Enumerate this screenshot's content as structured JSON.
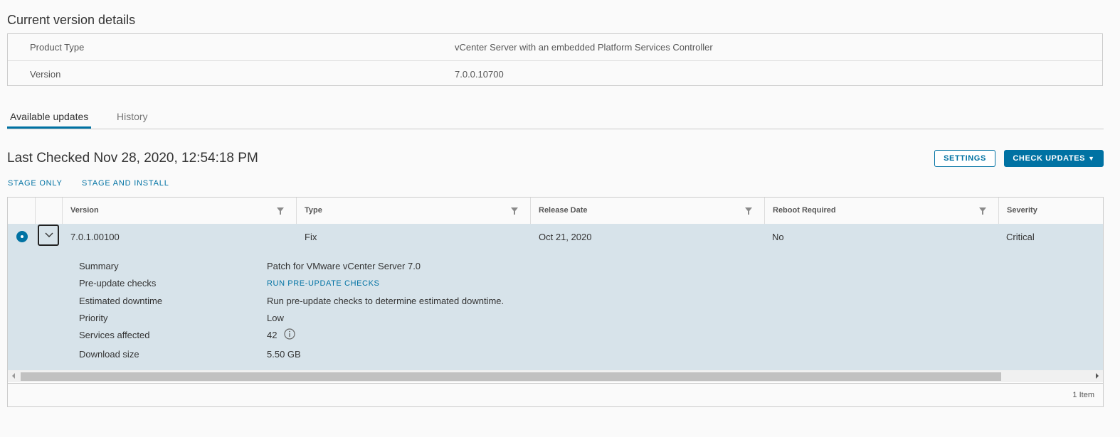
{
  "current_version": {
    "title": "Current version details",
    "rows": [
      {
        "label": "Product Type",
        "value": "vCenter Server with an embedded Platform Services Controller"
      },
      {
        "label": "Version",
        "value": "7.0.0.10700"
      }
    ]
  },
  "tabs": [
    {
      "label": "Available updates",
      "active": true
    },
    {
      "label": "History",
      "active": false
    }
  ],
  "updates": {
    "last_checked": "Last Checked Nov 28, 2020, 12:54:18 PM",
    "settings_label": "SETTINGS",
    "check_updates_label": "CHECK UPDATES",
    "stage_only_label": "STAGE ONLY",
    "stage_install_label": "STAGE AND INSTALL"
  },
  "grid": {
    "columns": [
      "Version",
      "Type",
      "Release Date",
      "Reboot Required",
      "Severity"
    ],
    "row": {
      "version": "7.0.1.00100",
      "type": "Fix",
      "release_date": "Oct 21, 2020",
      "reboot_required": "No",
      "severity": "Critical"
    },
    "details": {
      "summary_label": "Summary",
      "summary_value": "Patch for VMware vCenter Server 7.0",
      "prechecks_label": "Pre-update checks",
      "prechecks_link": "RUN PRE-UPDATE CHECKS",
      "downtime_label": "Estimated downtime",
      "downtime_value": "Run pre-update checks to determine estimated downtime.",
      "priority_label": "Priority",
      "priority_value": "Low",
      "services_label": "Services affected",
      "services_value": "42",
      "download_label": "Download size",
      "download_value": "5.50 GB"
    },
    "footer": "1 Item"
  },
  "colors": {
    "accent": "#0072a3",
    "selected_row": "#d7e3ea"
  }
}
